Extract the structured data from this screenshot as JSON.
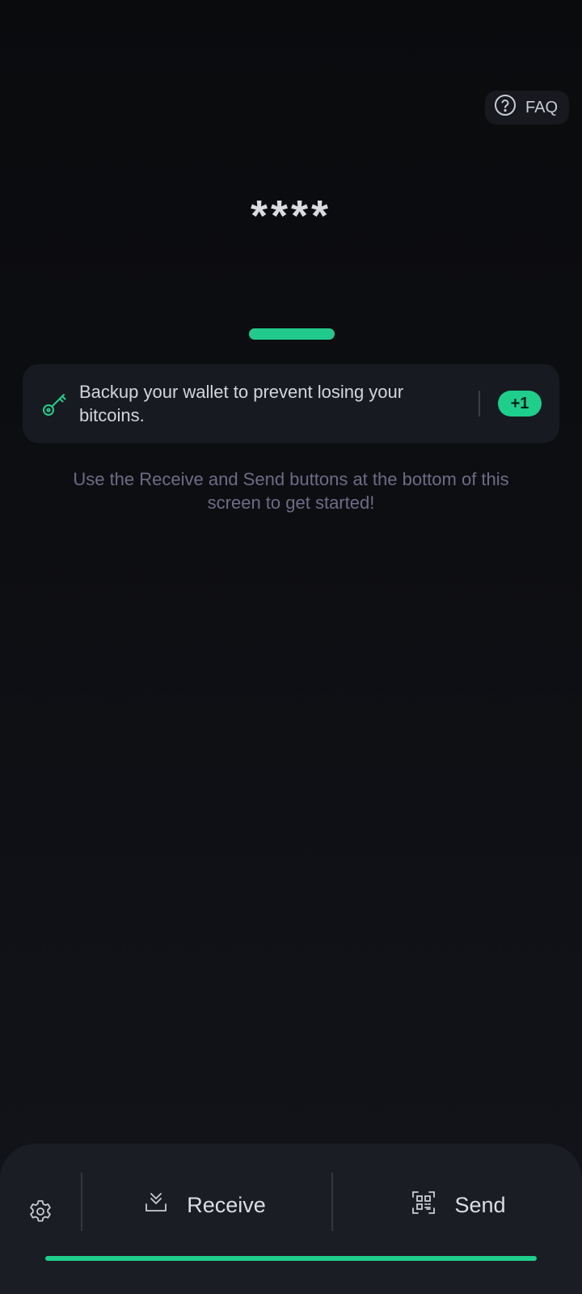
{
  "header": {
    "faq_label": "FAQ",
    "faq_icon": "help-circle-icon"
  },
  "balance": {
    "masked_value": "****"
  },
  "backup_card": {
    "icon": "key-icon",
    "message": "Backup your wallet to prevent losing your bitcoins.",
    "badge": "+1"
  },
  "hint": {
    "text": "Use the Receive and Send buttons at the bottom of this screen to get started!"
  },
  "bottom_nav": {
    "settings_icon": "gear-icon",
    "receive_label": "Receive",
    "receive_icon": "download-icon",
    "send_label": "Send",
    "send_icon": "qr-scan-icon"
  },
  "colors": {
    "accent": "#1ecf8c",
    "background": "#0b0c0f",
    "card": "#171a20",
    "hint_text": "#6d6c86"
  }
}
